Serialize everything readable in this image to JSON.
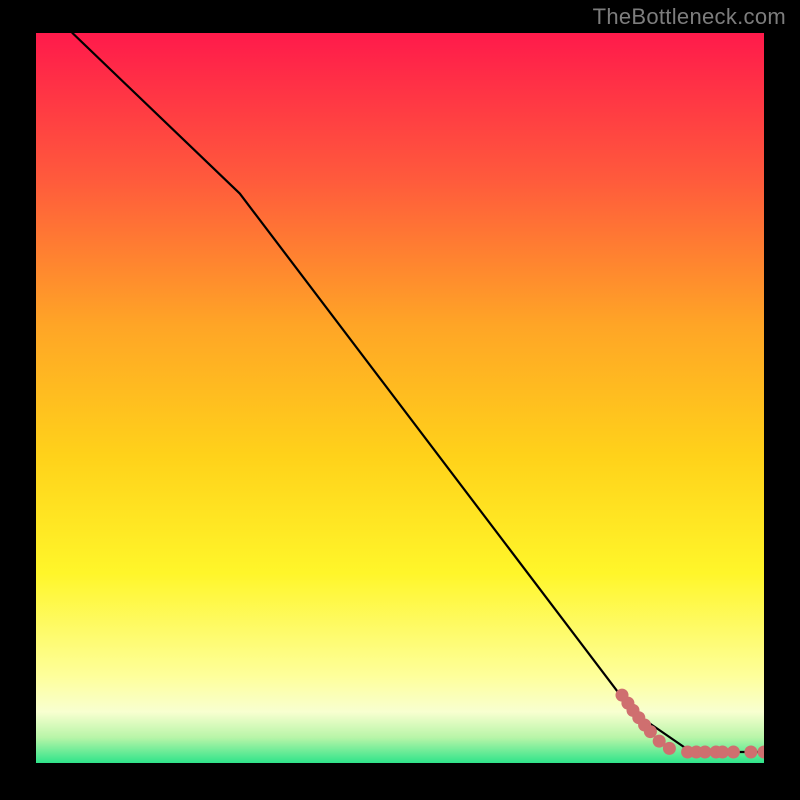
{
  "watermark": "TheBottleneck.com",
  "colors": {
    "top": "#ff1a4b",
    "mid1": "#ff6b36",
    "mid2": "#ffa526",
    "mid3": "#ffd21a",
    "mid4": "#fff62a",
    "pale": "#feffc4",
    "green": "#2fe48a",
    "curve": "#000000",
    "marker_fill": "#cf6f6f",
    "marker_stroke": "#b45a5a"
  },
  "chart_data": {
    "type": "line",
    "title": "",
    "xlabel": "",
    "ylabel": "",
    "xlim": [
      0,
      100
    ],
    "ylim": [
      0,
      100
    ],
    "series": [
      {
        "name": "curve",
        "x": [
          5,
          28,
          82,
          90,
          100
        ],
        "y": [
          100,
          78,
          7,
          1.5,
          1.5
        ]
      },
      {
        "name": "markers",
        "x": [
          80.5,
          81.3,
          82.0,
          82.8,
          83.6,
          84.4,
          85.6,
          87.0,
          89.5,
          90.7,
          91.9,
          93.4,
          94.3,
          95.8,
          98.2,
          100.0
        ],
        "y": [
          9.3,
          8.2,
          7.2,
          6.2,
          5.2,
          4.3,
          3.0,
          2.0,
          1.5,
          1.5,
          1.5,
          1.5,
          1.5,
          1.5,
          1.5,
          1.5
        ]
      }
    ]
  }
}
